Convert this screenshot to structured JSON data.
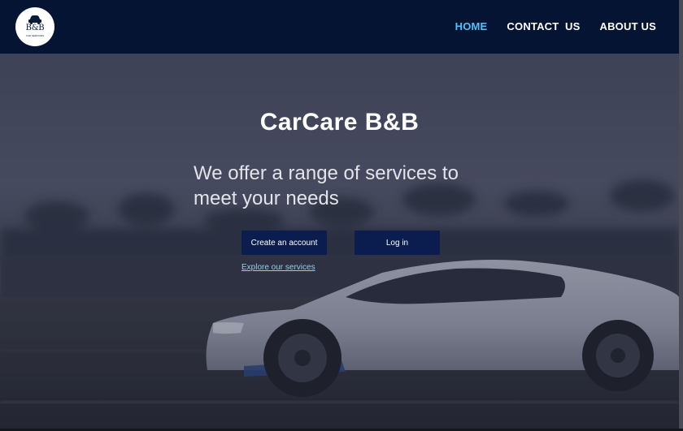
{
  "header": {
    "logo": {
      "main": "B&B",
      "sub": "CAR SERVICES",
      "icon": "car-icon"
    },
    "nav": [
      {
        "label": "HOME",
        "active": true
      },
      {
        "label": "CONTACT  US",
        "active": false
      },
      {
        "label": "ABOUT US",
        "active": false
      }
    ],
    "active_color": "#4fc3f7",
    "background": "#061433"
  },
  "hero": {
    "title": "CarCare B&B",
    "subtitle": "We offer a range of services to meet your needs",
    "buttons": {
      "create": "Create an account",
      "login": "Log in"
    },
    "link": "Explore our services",
    "button_color": "#0b1d4e",
    "link_color": "#8fd0ee",
    "image": "white sports car on road"
  }
}
